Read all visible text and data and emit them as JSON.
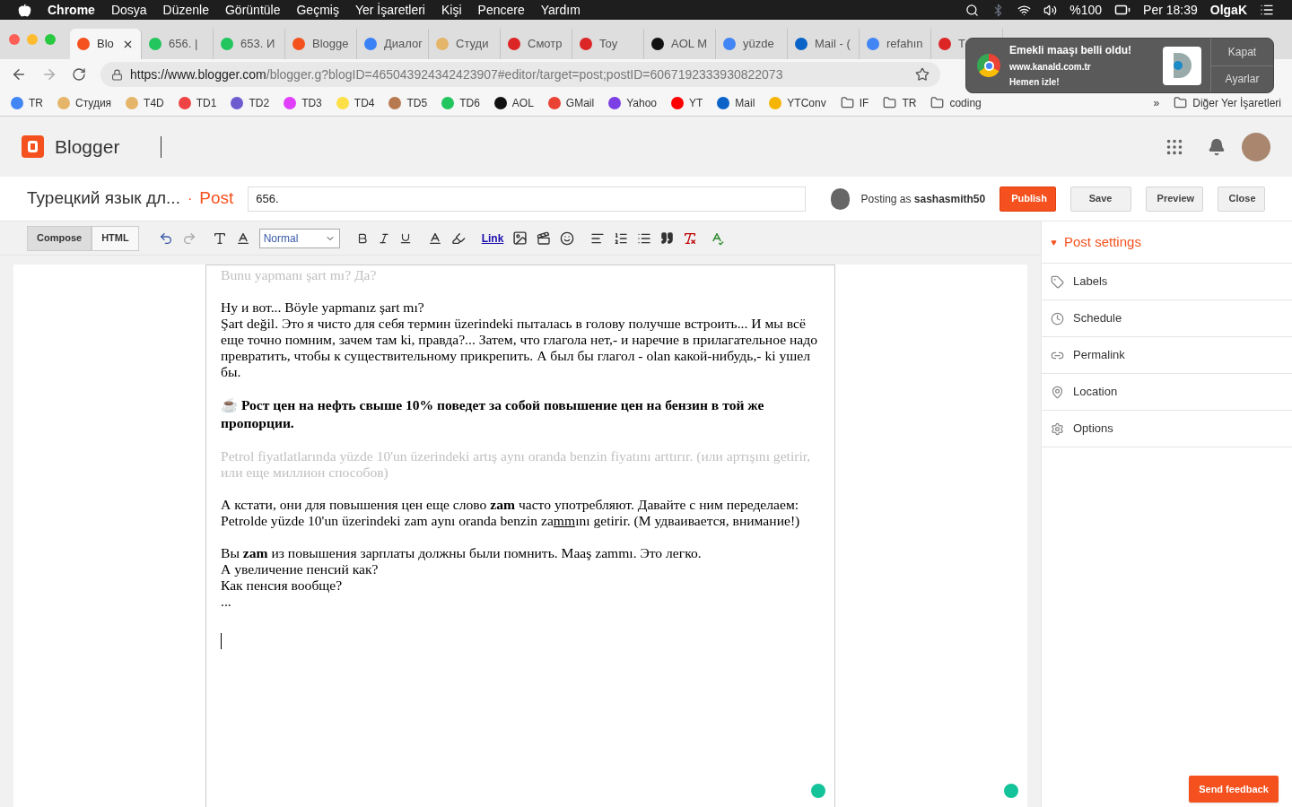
{
  "menu_bar": {
    "app": "Chrome",
    "items": [
      "Dosya",
      "Düzenle",
      "Görüntüle",
      "Geçmiş",
      "Yer İşaretleri",
      "Kişi",
      "Pencere",
      "Yardım"
    ],
    "battery": "%100",
    "clock": "Per 18:39",
    "user": "OlgaK"
  },
  "tabs": [
    {
      "label": "Blo",
      "selected": true,
      "color": "#f4511e"
    },
    {
      "label": "656. |",
      "selected": false,
      "color": "#22c55e"
    },
    {
      "label": "653. И",
      "selected": false,
      "color": "#22c55e"
    },
    {
      "label": "Blogge",
      "selected": false,
      "color": "#f4511e"
    },
    {
      "label": "Диалог",
      "selected": false,
      "color": "#3b82f6"
    },
    {
      "label": "Студи",
      "selected": false,
      "color": "#e5b56a"
    },
    {
      "label": "Смотр",
      "selected": false,
      "color": "#dc2626"
    },
    {
      "label": "Toy",
      "selected": false,
      "color": "#dc2626"
    },
    {
      "label": "AOL M",
      "selected": false,
      "color": "#111111"
    },
    {
      "label": "yüzde",
      "selected": false,
      "color": "#4285f4"
    },
    {
      "label": "Mail - (",
      "selected": false,
      "color": "#0a64c8"
    },
    {
      "label": "refahın",
      "selected": false,
      "color": "#4285f4"
    },
    {
      "label": "T",
      "selected": false,
      "color": "#dc2626"
    }
  ],
  "address": {
    "host": "https://www.blogger.com",
    "path": "/blogger.g?blogID=465043924342423907#editor/target=post;postID=6067192333930822073"
  },
  "bookmarks": [
    {
      "label": "TR",
      "color": "#4285f4"
    },
    {
      "label": "Студия",
      "color": "#e5b56a"
    },
    {
      "label": "T4D",
      "color": "#e5b56a"
    },
    {
      "label": "TD1",
      "color": "#ef4444"
    },
    {
      "label": "TD2",
      "color": "#6d5bd0"
    },
    {
      "label": "TD3",
      "color": "#e040fb"
    },
    {
      "label": "TD4",
      "color": "#fde047"
    },
    {
      "label": "TD5",
      "color": "#b7794f"
    },
    {
      "label": "TD6",
      "color": "#22c55e"
    },
    {
      "label": "AOL",
      "color": "#111111"
    },
    {
      "label": "GMail",
      "color": "#ea4335"
    },
    {
      "label": "Yahoo",
      "color": "#7b3fe4"
    },
    {
      "label": "YT",
      "color": "#ff0000"
    },
    {
      "label": "Mail",
      "color": "#0a64c8"
    },
    {
      "label": "YTConv",
      "color": "#f4b400"
    },
    {
      "label": "IF",
      "kind": "folder"
    },
    {
      "label": "TR",
      "kind": "folder"
    },
    {
      "label": "coding",
      "kind": "folder"
    }
  ],
  "bookmarks_more": "»",
  "other_bookmarks": "Diğer Yer İşaretleri",
  "notification": {
    "title": "Emekli maaşı belli oldu!",
    "site": "www.kanald.com.tr",
    "body": "Hemen izle!",
    "buttons": [
      "Kapat",
      "Ayarlar"
    ]
  },
  "blogger": {
    "brand": "Blogger"
  },
  "post": {
    "blog_title": "Турецкий язык дл...",
    "separator": "·",
    "section": "Post",
    "title_value": "656.",
    "posting_as": "Posting as",
    "user": "sashasmith50",
    "buttons": [
      {
        "label": "Publish",
        "kind": "primary"
      },
      {
        "label": "Save",
        "kind": "default"
      },
      {
        "label": "Preview",
        "kind": "default"
      },
      {
        "label": "Close",
        "kind": "default"
      }
    ]
  },
  "modes": [
    {
      "label": "Compose",
      "selected": true
    },
    {
      "label": "HTML",
      "selected": false
    }
  ],
  "format_select": "Normal",
  "link_label": "Link",
  "paragraphs": [
    {
      "kind": "faded",
      "lines": [
        "Bunu yapmanı şart mı? Да?"
      ]
    },
    {
      "kind": "normal",
      "lines": [
        "Ну и вот... Böyle yapmanız şart mı?",
        "Şart değil. Это я чисто для себя термин üzerindeki пыталась в голову получше встроить... И мы всё еще точно помним, зачем там ki, правда?... Затем, что глагола нет,- и наречие в прилагательное надо превратить, чтобы к существительному прикрепить. А был бы глагол - olan какой-нибудь,- ki ушел бы."
      ]
    },
    {
      "kind": "heading",
      "lines": [
        "☕ Рост цен на нефть свыше 10% поведет за собой повышение цен на бензин в той же пропорции."
      ]
    },
    {
      "kind": "faded",
      "lines": [
        "Petrol fiyatlatlarında yüzde 10'un üzerindeki artış aynı oranda benzin fiyatını arttırır. (или артışını getirir, или еще миллион способов)"
      ]
    },
    {
      "kind": "normal",
      "lines": [
        "А кстати, они для повышения цен еще слово **zam** часто употребляют. Давайте с ним переделаем:",
        [
          {
            "text": "Petrolde yüzde 10'un üzerindeki zam aynı oranda benzin za",
            "underlined": false
          },
          {
            "text": "mm",
            "underlined": true
          },
          {
            "text": "ını getirir. (М удваивается, внимание!)",
            "underlined": false
          }
        ]
      ]
    },
    {
      "kind": "normal",
      "lines": [
        "Вы **zam** из повышения зарплаты должны были помнить. Maaş zammı. Это легко.",
        "А увеличение пенсий как?",
        "Как пенсия вообще?",
        "..."
      ]
    }
  ],
  "sidebar": {
    "title": "Post settings",
    "items": [
      {
        "label": "Labels",
        "kind": "tag"
      },
      {
        "label": "Schedule",
        "kind": "clock"
      },
      {
        "label": "Permalink",
        "kind": "link"
      },
      {
        "label": "Location",
        "kind": "pin"
      },
      {
        "label": "Options",
        "kind": "gear"
      }
    ]
  },
  "feedback_button": "Send feedback"
}
